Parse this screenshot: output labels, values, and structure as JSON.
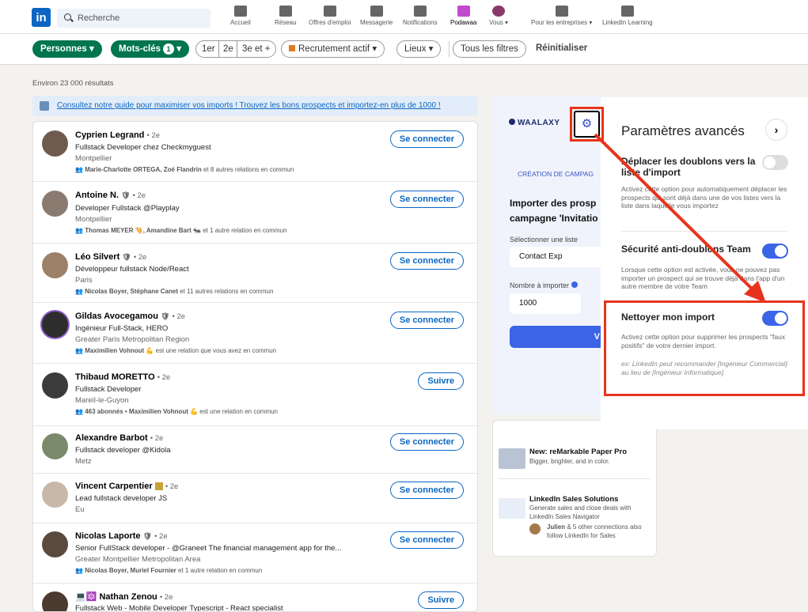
{
  "topbar": {
    "logo": "in",
    "search_placeholder": "Recherche",
    "nav": [
      {
        "label": "Accueil",
        "icon": "home-icon"
      },
      {
        "label": "Réseau",
        "icon": "network-icon"
      },
      {
        "label": "Offres d'emploi",
        "icon": "briefcase-icon"
      },
      {
        "label": "Messagerie",
        "icon": "message-icon"
      },
      {
        "label": "Notifications",
        "icon": "bell-icon"
      },
      {
        "label": "Podawaa",
        "icon": "podawaa-icon"
      },
      {
        "label": "Vous ▾",
        "icon": "avatar"
      },
      {
        "label": "Pour les entreprises ▾",
        "icon": "grid-icon"
      },
      {
        "label": "LinkedIn Learning",
        "icon": "play-icon"
      }
    ]
  },
  "filters": {
    "personnes": "Personnes ▾",
    "mots_cles": "Mots-clés",
    "mots_cles_count": "1",
    "first": "1er",
    "second": "2e",
    "third": "3e et +",
    "recruit": "Recrutement actif ▾",
    "lieux": "Lieux ▾",
    "tous": "Tous les filtres",
    "reset": "Réinitialiser"
  },
  "results_count": "Environ 23 000 résultats",
  "banner": "Consultez notre guide pour maximiser vos imports ! Trouvez les bons prospects et importez-en plus de 1000 !",
  "people": [
    {
      "name": "Cyprien Legrand",
      "degree": "• 2e",
      "title": "Fullstack Developer chez Checkmyguest",
      "location": "Montpellier",
      "mutual_names": "Marie-Charlotte ORTEGA, Zoé Flandrin",
      "mutual_rest": "et 8 autres relations en commun",
      "action": "Se connecter"
    },
    {
      "name": "Antoine N.",
      "degree": "• 2e",
      "title": "Developer Fullstack @Playplay",
      "location": "Montpellier",
      "mutual_names": "Thomas MEYER 🐪, Amandine Bart 🐜",
      "mutual_rest": "et 1 autre relation en commun",
      "action": "Se connecter"
    },
    {
      "name": "Léo Silvert",
      "degree": "• 2e",
      "title": "Développeur fullstack Node/React",
      "location": "Paris",
      "mutual_names": "Nicolas Boyer, Stéphane Canet",
      "mutual_rest": "et 11 autres relations en commun",
      "action": "Se connecter"
    },
    {
      "name": "Gildas Avocegamou",
      "degree": "• 2e",
      "title": "Ingénieur Full-Stack, HERO",
      "location": "Greater Paris Metropolitan Region",
      "mutual_names": "Maximilien Vohnout 💪",
      "mutual_rest": "est une relation que vous avez en commun",
      "action": "Se connecter"
    },
    {
      "name": "Thibaud MORETTO",
      "degree": "• 2e",
      "title": "Fullstack Developer",
      "location": "Mareil-le-Guyon",
      "mutual_names": "463 abonnés • Maximilien Vohnout 💪",
      "mutual_rest": "est une relation en commun",
      "action": "Suivre"
    },
    {
      "name": "Alexandre Barbot",
      "degree": "• 2e",
      "title": "Fullstack developer @Kidola",
      "location": "Metz",
      "mutual_names": "",
      "mutual_rest": "",
      "action": "Se connecter"
    },
    {
      "name": "Vincent Carpentier",
      "degree": "• 2e",
      "title": "Lead fullstack developer JS",
      "location": "Eu",
      "mutual_names": "",
      "mutual_rest": "",
      "action": "Se connecter"
    },
    {
      "name": "Nicolas Laporte",
      "degree": "• 2e",
      "title": "Senior FullStack developer - @Graneet The financial management app for the...",
      "location": "Greater Montpellier Metropolitan Area",
      "mutual_names": "Nicolas Boyer, Muriel Fournier",
      "mutual_rest": "et 1 autre relation en commun",
      "action": "Se connecter"
    },
    {
      "name": "💻🔯 Nathan Zenou",
      "degree": "• 2e",
      "title": "Fullstack Web - Mobile Developer Typescript - React specialist",
      "location": "",
      "mutual_names": "",
      "mutual_rest": "",
      "action": "Suivre"
    }
  ],
  "waalaxy": {
    "logo": "WAALAXY",
    "campaign_label": "CRÉATION DE CAMPAG",
    "import_title_1": "Importer des prosp",
    "import_title_2": "campagne 'Invitatio",
    "select_label": "Sélectionner une liste",
    "select_value": "Contact Exp",
    "count_label": "Nombre à importer",
    "count_value": "1000",
    "button": "V"
  },
  "ads": [
    {
      "title": "New: reMarkable Paper Pro",
      "desc": "Bigger, brighter, and in color."
    },
    {
      "title": "LinkedIn Sales Solutions",
      "desc": "Generate sales and close deals with LinkedIn Sales Navigator",
      "social_name": "Julien",
      "social_rest": "& 5 other connections also follow LinkedIn for Sales"
    }
  ],
  "settings": {
    "title": "Paramètres avancés",
    "items": [
      {
        "heading": "Déplacer les doublons vers la liste d'import",
        "desc": "Activez cette option pour automatiquement déplacer les prospects qui sont déjà dans une de vos listes vers la liste dans laquelle vous importez",
        "on": false
      },
      {
        "heading": "Sécurité anti-doublons Team",
        "desc": "Lorsque cette option est activée, vous ne pouvez pas importer un prospect qui se trouve déjà dans l'app d'un autre membre de votre Team",
        "on": true
      },
      {
        "heading": "Nettoyer mon import",
        "desc": "Activez cette option pour supprimer les prospects \"faux positifs\" de votre dernier import.",
        "example": "ex: LinkedIn peut recommander [Ingénieur Commercial] au lieu de [Ingénieur Informatique].",
        "on": true
      }
    ]
  },
  "colors": {
    "linkedin_blue": "#0a66c2",
    "filter_green": "#01754f",
    "waalaxy_blue": "#3b64e6",
    "annotation_red": "#e8331c"
  }
}
